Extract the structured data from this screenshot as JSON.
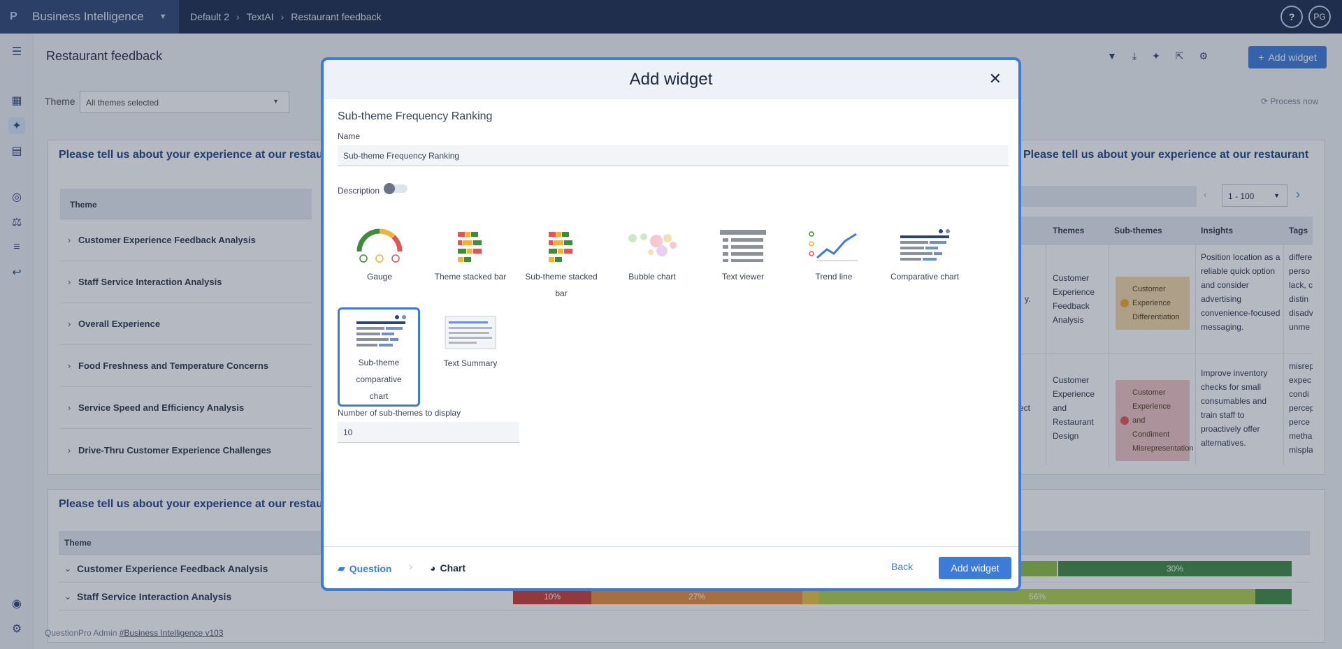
{
  "topbar": {
    "logo": "P",
    "app_name": "Business Intelligence",
    "breadcrumbs": [
      "Default 2",
      "TextAI",
      "Restaurant feedback"
    ],
    "help": "?",
    "avatar": "PG"
  },
  "page": {
    "title": "Restaurant feedback",
    "add_widget": "Add widget",
    "theme_label": "Theme",
    "theme_value": "All themes selected",
    "process_now": "Process now"
  },
  "panel1": {
    "title": "Please tell us about your experience at our restaurant",
    "col_theme": "Theme",
    "rows": [
      "Customer Experience Feedback Analysis",
      "Staff Service Interaction Analysis",
      "Overall Experience",
      "Food Freshness and Temperature Concerns",
      "Service Speed and Efficiency Analysis",
      "Drive-Thru Customer Experience Challenges"
    ]
  },
  "panel2": {
    "title": "Please tell us about your experience at our restaurant",
    "pager": "1 - 100",
    "cols": [
      "Themes",
      "Sub-themes",
      "Insights",
      "Tags"
    ],
    "row1": {
      "frag": "y.",
      "theme": "Customer Experience Feedback Analysis",
      "subtheme": "Customer Experience Differentiation",
      "insight": "Position location as a reliable quick option and consider advertising convenience-focused messaging.",
      "tags": "differe perso lack, c distin disadv unme"
    },
    "row2": {
      "frag": "ect",
      "theme": "Customer Experience and Restaurant Design",
      "subtheme": "Customer Experience and Condiment Misrepresentation",
      "insight": "Improve inventory checks for small consumables and train staff to proactively offer alternatives.",
      "tags": "misrep expec condi percep perce metha mispla"
    }
  },
  "panel3": {
    "title": "Please tell us about your experience at our restaurant",
    "col_theme": "Theme",
    "rows": [
      "Customer Experience Feedback Analysis",
      "Staff Service Interaction Analysis"
    ],
    "bar1": {
      "last_pct": 30,
      "last_label": "30%"
    },
    "bar2": {
      "segments": [
        {
          "pct": 10,
          "label": "10%"
        },
        {
          "pct": 27,
          "label": "27%"
        },
        {
          "pct": 56,
          "label": "56%"
        }
      ]
    }
  },
  "footer": {
    "text": "QuestionPro Admin",
    "link": "#Business Intelligence v103"
  },
  "modal": {
    "title": "Add widget",
    "close": "✕",
    "section_title": "Sub-theme Frequency Ranking",
    "name_label": "Name",
    "name_value": "Sub-theme Frequency Ranking",
    "description_label": "Description",
    "chart_options": [
      {
        "label": "Gauge",
        "icon": "gauge-icon"
      },
      {
        "label": "Theme stacked bar",
        "icon": "stacked-bar-icon"
      },
      {
        "label": "Sub-theme stacked bar",
        "icon": "stacked-bar-icon"
      },
      {
        "label": "Bubble chart",
        "icon": "bubble-chart-icon"
      },
      {
        "label": "Text viewer",
        "icon": "text-viewer-icon"
      },
      {
        "label": "Trend line",
        "icon": "trend-line-icon"
      },
      {
        "label": "Comparative chart",
        "icon": "comparative-chart-icon"
      },
      {
        "label": "Sub-theme comparative chart",
        "icon": "comparative-chart-icon",
        "selected": true
      },
      {
        "label": "Text Summary",
        "icon": "text-summary-icon"
      }
    ],
    "num_label": "Number of sub-themes to display",
    "num_value": "10",
    "step1": "Question",
    "step2": "Chart",
    "back": "Back",
    "add": "Add widget"
  },
  "colors": {
    "accent": "#3d7bd9",
    "nav": "#1a2a4a",
    "brand": "#2d4474",
    "title_blue": "#1b3f86"
  }
}
